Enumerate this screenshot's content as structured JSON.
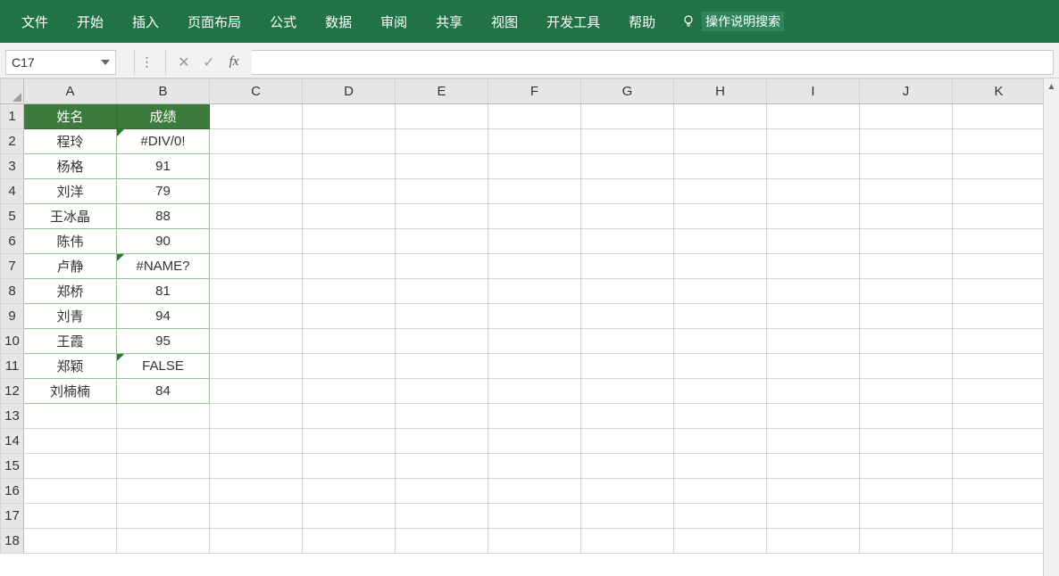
{
  "ribbon": {
    "tabs": [
      "文件",
      "开始",
      "插入",
      "页面布局",
      "公式",
      "数据",
      "审阅",
      "共享",
      "视图",
      "开发工具",
      "帮助"
    ],
    "search_placeholder": "操作说明搜索"
  },
  "formula_bar": {
    "name_box": "C17",
    "cancel_label": "✕",
    "confirm_label": "✓",
    "fx_label": "fx",
    "formula_value": ""
  },
  "columns": [
    "A",
    "B",
    "C",
    "D",
    "E",
    "F",
    "G",
    "H",
    "I",
    "J",
    "K"
  ],
  "row_count": 18,
  "headers": {
    "A": "姓名",
    "B": "成绩"
  },
  "data_rows": [
    {
      "A": "程玲",
      "B": "#DIV/0!",
      "err": true
    },
    {
      "A": "杨格",
      "B": "91"
    },
    {
      "A": "刘洋",
      "B": "79"
    },
    {
      "A": "王冰晶",
      "B": "88"
    },
    {
      "A": "陈伟",
      "B": "90"
    },
    {
      "A": "卢静",
      "B": "#NAME?",
      "err": true
    },
    {
      "A": "郑桥",
      "B": "81"
    },
    {
      "A": "刘青",
      "B": "94"
    },
    {
      "A": "王霞",
      "B": "95"
    },
    {
      "A": "郑颖",
      "B": "FALSE",
      "err": true
    },
    {
      "A": "刘楠楠",
      "B": "84"
    }
  ]
}
